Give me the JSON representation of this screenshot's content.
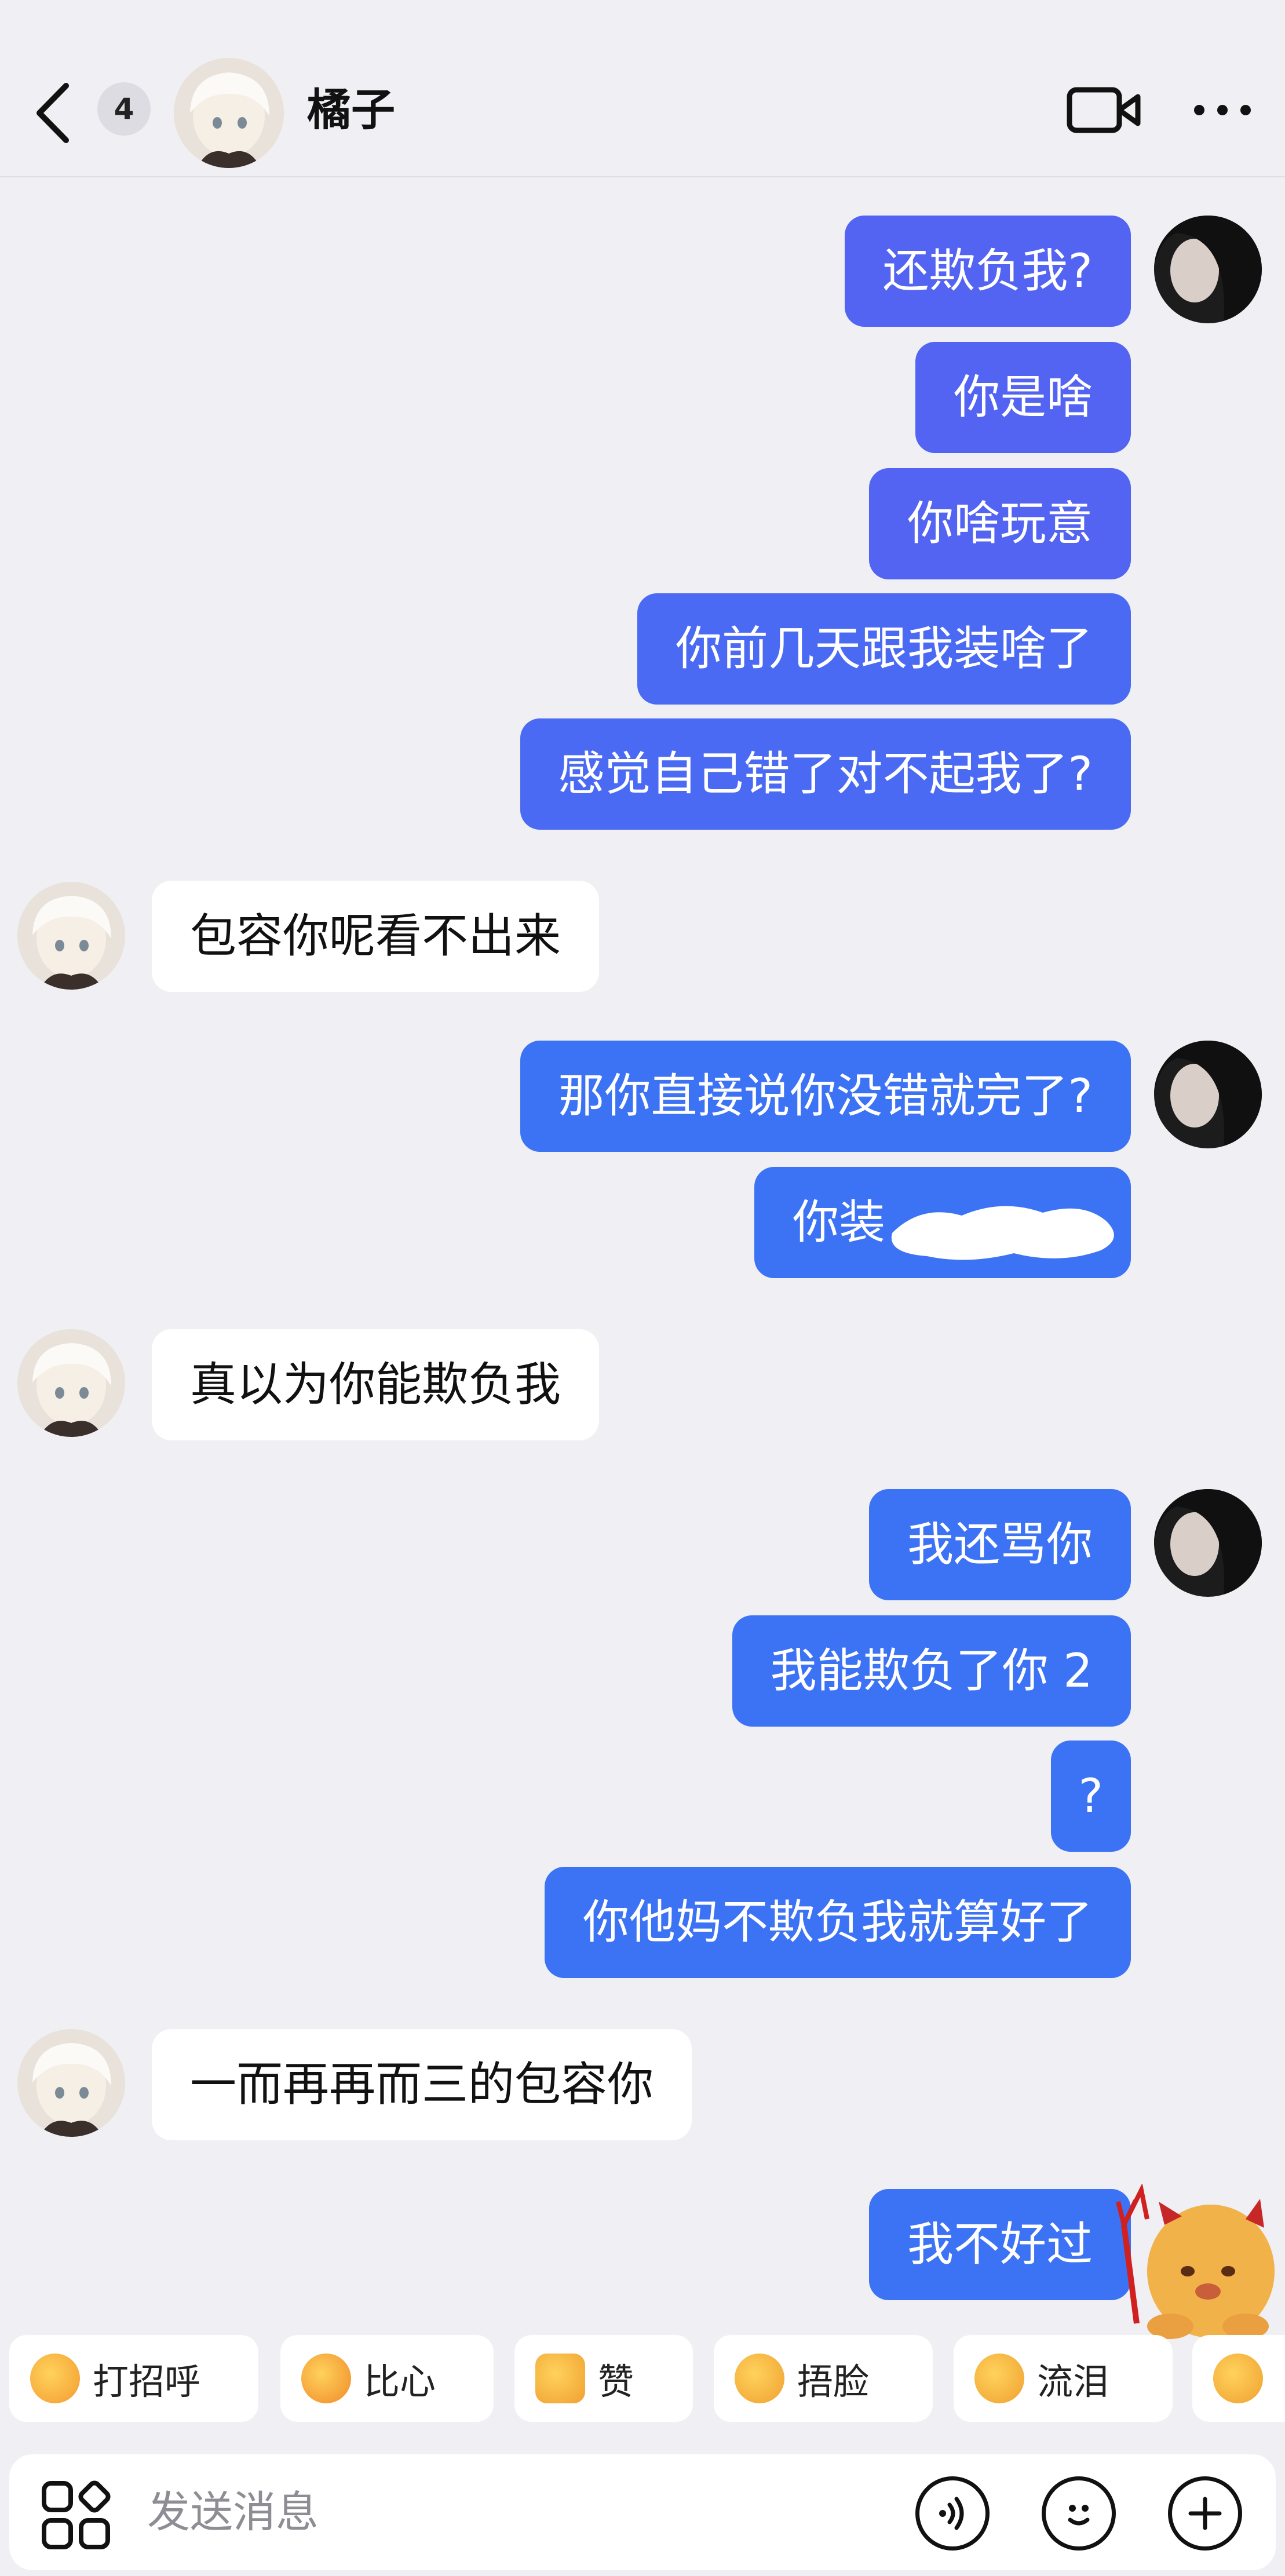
{
  "header": {
    "back_label": "back",
    "unread_count": "4",
    "contact_name": "橘子"
  },
  "messages": [
    {
      "side": "out",
      "text": "还欺负我?"
    },
    {
      "side": "out",
      "text": "你是啥"
    },
    {
      "side": "out",
      "text": "你啥玩意"
    },
    {
      "side": "out",
      "text": "你前几天跟我装啥了"
    },
    {
      "side": "out",
      "text": "感觉自己错了对不起我了?"
    },
    {
      "side": "in",
      "text": "包容你呢看不出来"
    },
    {
      "side": "out",
      "text": "那你直接说你没错就完了?"
    },
    {
      "side": "out",
      "text": "你装",
      "partially_hidden": true
    },
    {
      "side": "in",
      "text": "真以为你能欺负我"
    },
    {
      "side": "out",
      "text": "我还骂你"
    },
    {
      "side": "out",
      "text": "我能欺负了你 2"
    },
    {
      "side": "out",
      "text": "?"
    },
    {
      "side": "out",
      "text": "你他妈不欺负我就算好了"
    },
    {
      "side": "in",
      "text": "一而再再而三的包容你"
    },
    {
      "side": "out",
      "text": "我不好过"
    }
  ],
  "quick_reactions": [
    {
      "label": "打招呼",
      "icon": "wave-emoji-icon"
    },
    {
      "label": "比心",
      "icon": "heart-hands-emoji-icon"
    },
    {
      "label": "赞",
      "icon": "thumbs-up-emoji-icon"
    },
    {
      "label": "捂脸",
      "icon": "facepalm-emoji-icon"
    },
    {
      "label": "流泪",
      "icon": "crying-emoji-icon"
    }
  ],
  "input": {
    "placeholder": "发送消息"
  },
  "colors": {
    "background": "#efeff4",
    "outgoing_bubble": "#3c72f4",
    "incoming_bubble": "#ffffff"
  }
}
